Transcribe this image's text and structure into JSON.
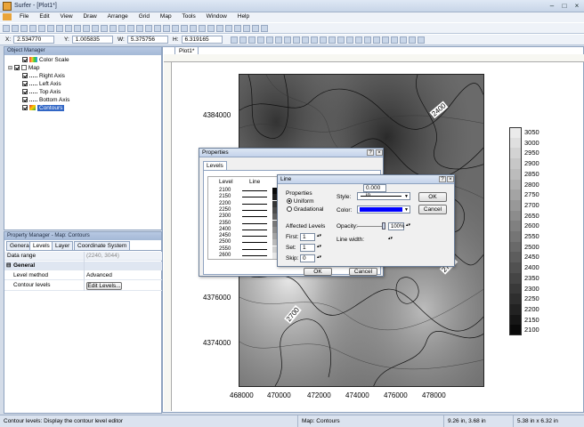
{
  "window": {
    "title": "Surfer - [Plot1*]"
  },
  "menu": [
    "File",
    "Edit",
    "View",
    "Draw",
    "Arrange",
    "Grid",
    "Map",
    "Tools",
    "Window",
    "Help"
  ],
  "coords": {
    "x_label": "X:",
    "x_value": "2.534770",
    "y_label": "Y:",
    "y_value": "1.005835",
    "w_label": "W:",
    "w_value": "5.375756",
    "h_label": "H:",
    "h_value": "6.319165"
  },
  "object_manager": {
    "title": "Object Manager",
    "items": [
      {
        "label": "Color Scale",
        "checked": true,
        "selected": false
      },
      {
        "label": "Map",
        "checked": true,
        "selected": false
      },
      {
        "label": "Right Axis",
        "checked": true,
        "selected": false
      },
      {
        "label": "Left Axis",
        "checked": true,
        "selected": false
      },
      {
        "label": "Top Axis",
        "checked": true,
        "selected": false
      },
      {
        "label": "Bottom Axis",
        "checked": true,
        "selected": false
      },
      {
        "label": "Contours",
        "checked": true,
        "selected": true
      }
    ]
  },
  "property_manager": {
    "title": "Property Manager - Map: Contours",
    "tabs": [
      "General",
      "Levels",
      "Layer",
      "Coordinate System"
    ],
    "active_tab": "Levels",
    "data_range_label": "Data range",
    "data_range_value": "(2240, 3044)",
    "section": "General",
    "rows": [
      {
        "name": "Level method",
        "value": "Advanced"
      },
      {
        "name": "Contour levels",
        "value": "Edit Levels..."
      }
    ]
  },
  "doc_tab": "Plot1*",
  "map": {
    "y_ticks": [
      "4384000",
      "4376000",
      "4374000"
    ],
    "x_ticks": [
      "468000",
      "470000",
      "472000",
      "474000",
      "476000",
      "478000"
    ],
    "contour_labels": [
      "2400",
      "2700",
      "2700"
    ]
  },
  "color_scale": [
    "3050",
    "3000",
    "2950",
    "2900",
    "2850",
    "2800",
    "2750",
    "2700",
    "2650",
    "2600",
    "2550",
    "2500",
    "2450",
    "2400",
    "2350",
    "2300",
    "2250",
    "2200",
    "2150",
    "2100"
  ],
  "properties_dialog": {
    "title": "Properties",
    "tab": "Levels",
    "columns": [
      "Level",
      "Line",
      "F"
    ],
    "levels": [
      "2100",
      "2150",
      "2200",
      "2250",
      "2300",
      "2350",
      "2400",
      "2450",
      "2500",
      "2550",
      "2600"
    ],
    "ok": "OK",
    "cancel": "Cancel"
  },
  "line_dialog": {
    "title": "Line",
    "properties_label": "Properties",
    "uniform": "Uniform",
    "gradational": "Gradational",
    "affected_levels": "Affected Levels",
    "first_label": "First:",
    "first_value": "1",
    "set_label": "Set:",
    "set_value": "1",
    "skip_label": "Skip:",
    "skip_value": "0",
    "style_label": "Style:",
    "color_label": "Color:",
    "color": "#0000ff",
    "opacity_label": "Opacity:",
    "opacity_value": "100%",
    "linewidth_label": "Line width:",
    "linewidth_value": "0.000 in",
    "ok": "OK",
    "cancel": "Cancel"
  },
  "status": {
    "hint": "Contour levels: Display the contour level editor",
    "object": "Map: Contours",
    "cursor": "9.26 in, 3.68 in",
    "size": "5.38 in x 6.32 in"
  }
}
